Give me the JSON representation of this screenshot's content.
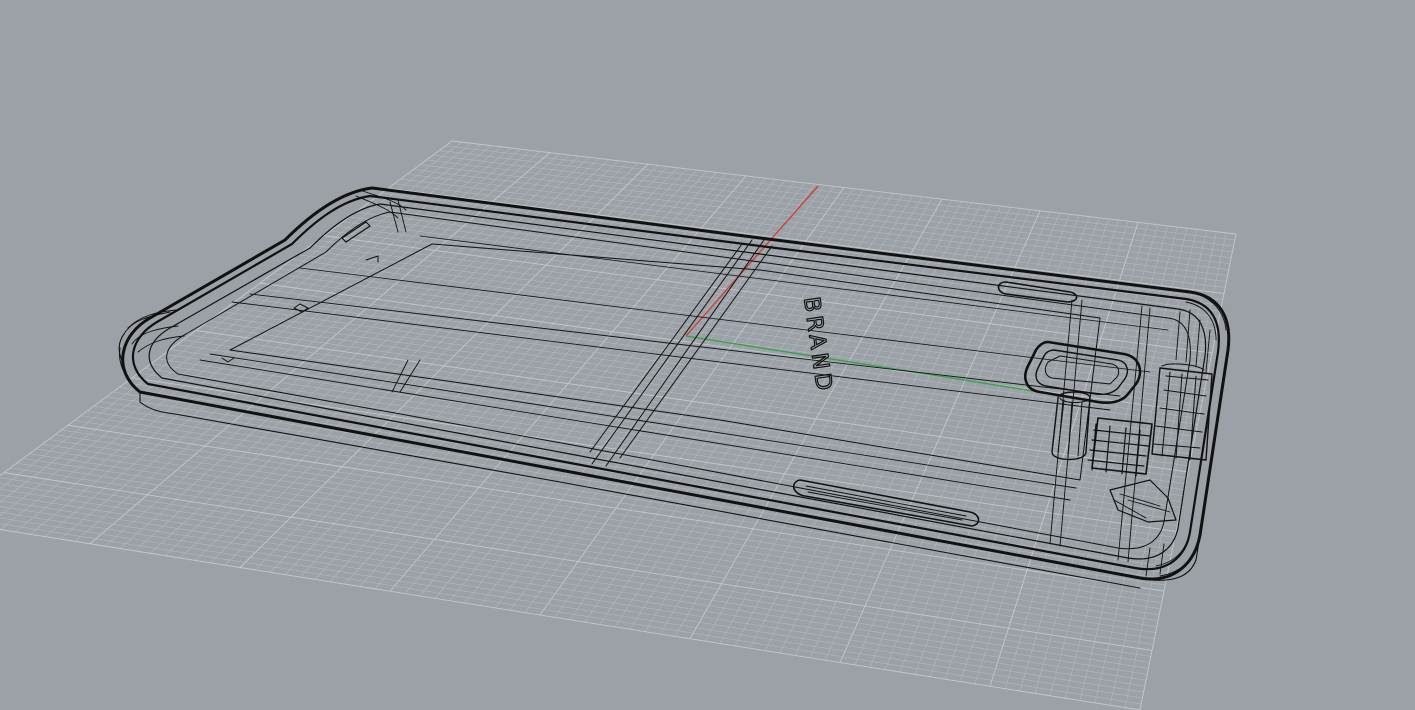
{
  "viewport": {
    "background_color": "#9ba1a7",
    "grid_color": "#b3b8bd",
    "grid_major_color": "#c4c8cc",
    "wire_color": "#111111",
    "x_axis_color": "#c8453a",
    "y_axis_color": "#3da04a",
    "brand_text": "BRAND"
  }
}
